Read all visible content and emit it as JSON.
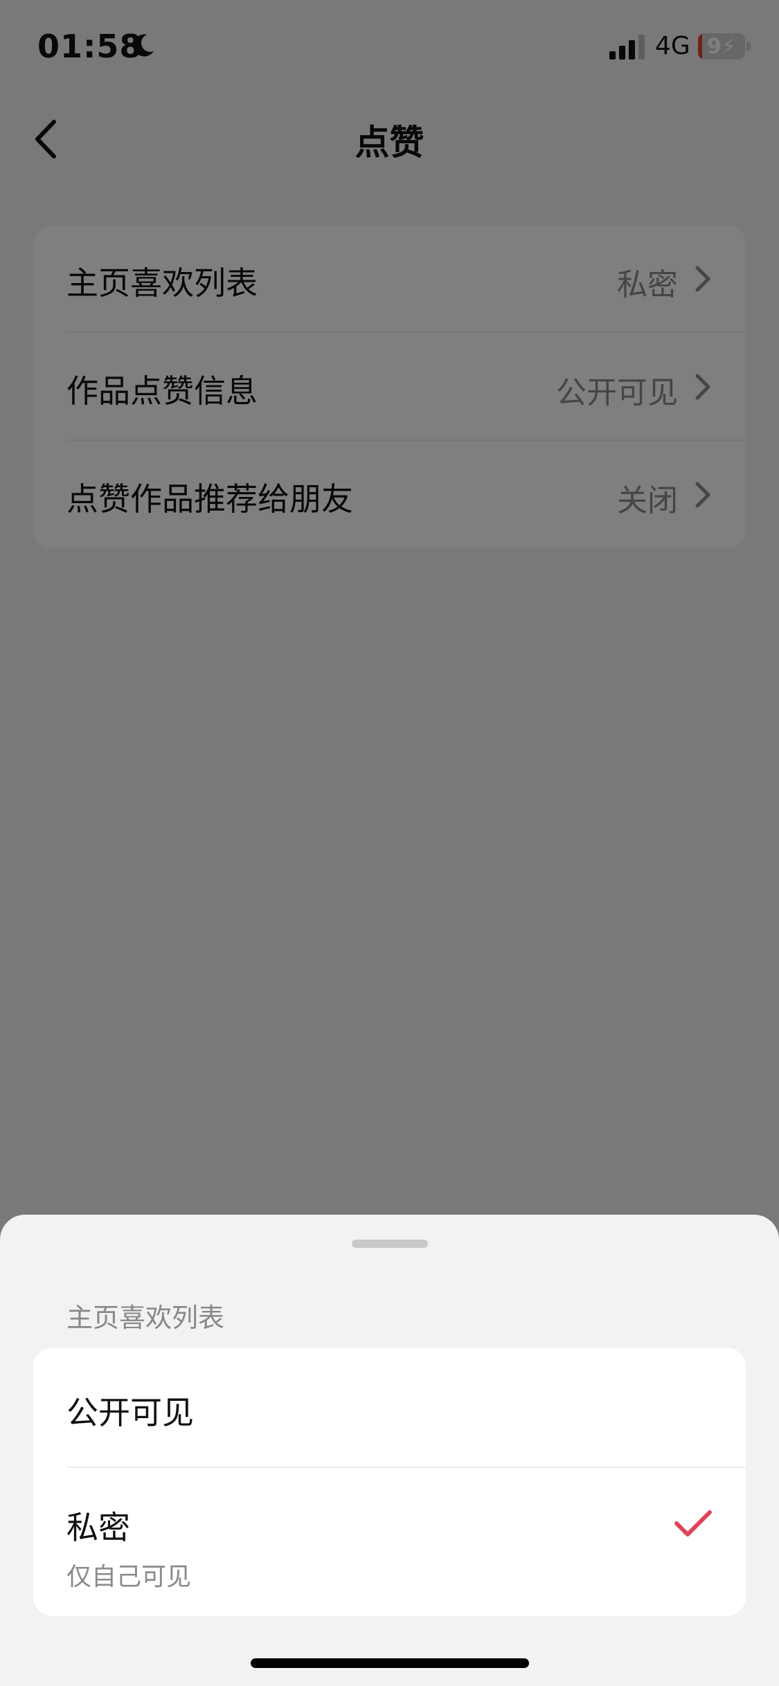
{
  "status_bar": {
    "time": "01:58",
    "network": "4G",
    "battery": "9",
    "battery_level_percent": 9,
    "icons": [
      "moon-icon",
      "signal-icon",
      "battery-icon"
    ]
  },
  "nav": {
    "title": "点赞",
    "back_icon": "chevron-left-icon"
  },
  "settings": {
    "rows": [
      {
        "label": "主页喜欢列表",
        "value": "私密"
      },
      {
        "label": "作品点赞信息",
        "value": "公开可见"
      },
      {
        "label": "点赞作品推荐给朋友",
        "value": "关闭"
      }
    ]
  },
  "sheet": {
    "title": "主页喜欢列表",
    "options": [
      {
        "label": "公开可见",
        "selected": false
      },
      {
        "label": "私密",
        "sublabel": "仅自己可见",
        "selected": true
      }
    ],
    "accent_color": "#e0435b"
  }
}
